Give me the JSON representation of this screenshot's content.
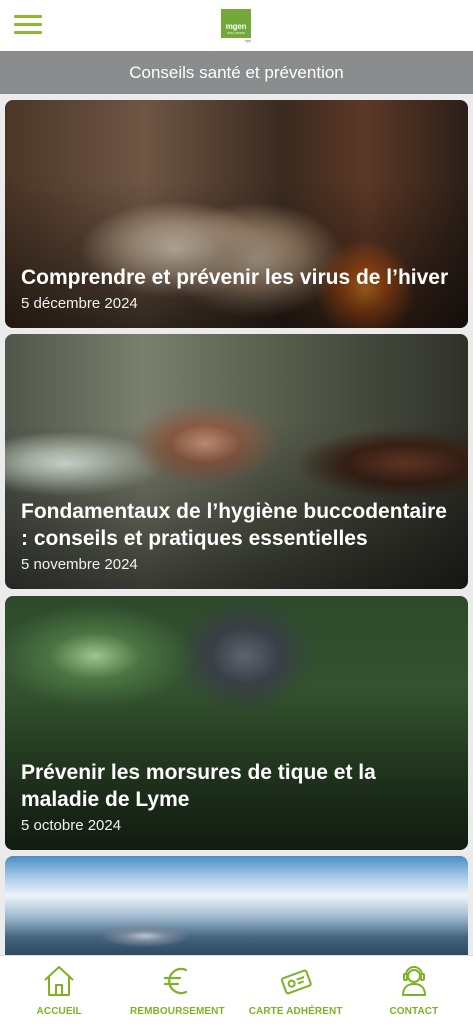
{
  "header": {
    "logo": {
      "brand": "mgen",
      "sub": "SOLUTIONS",
      "tagline": "vyv"
    },
    "menu_icon": "hamburger-icon"
  },
  "section": {
    "title": "Conseils santé et prévention"
  },
  "articles": [
    {
      "title": "Comprendre et prévenir les virus de l’hiver",
      "date": "5 décembre 2024"
    },
    {
      "title": "Fondamentaux de l’hygiène buccodentaire : conseils et pratiques essentielles",
      "date": "5 novembre 2024"
    },
    {
      "title": "Prévenir les morsures de tique et la maladie de Lyme",
      "date": "5 octobre 2024"
    },
    {
      "title": "",
      "date": ""
    }
  ],
  "bottom_nav": [
    {
      "label": "ACCUEIL",
      "icon": "home-icon"
    },
    {
      "label": "REMBOURSEMENT",
      "icon": "euro-icon"
    },
    {
      "label": "CARTE ADHÉRENT",
      "icon": "member-card-icon"
    },
    {
      "label": "CONTACT",
      "icon": "contact-icon"
    }
  ],
  "colors": {
    "accent": "#7fb126",
    "section_bg": "#8a8c8d",
    "logo_green": "#72a939"
  }
}
